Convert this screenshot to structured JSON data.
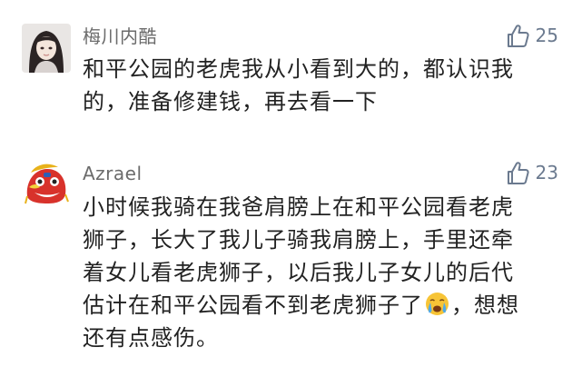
{
  "comments": [
    {
      "username": "梅川内酷",
      "likes": "25",
      "lines": [
        "和平公园的老虎我从小看到大的，都认识我",
        "的，准备修建钱，再去看一下"
      ]
    },
    {
      "username": "Azrael",
      "likes": "23",
      "lines": [
        "小时候我骑在我爸肩膀上在和平公园看老虎",
        "狮子，长大了我儿子骑我肩膀上，手里还牵",
        "着女儿看老虎狮子，以后我儿子女儿的后代",
        "估计在和平公园看不到老虎狮子了",
        "，想想",
        "还有点感伤。"
      ],
      "emoji": "crying-face-emoji"
    }
  ],
  "colors": {
    "like_icon": "#6b7a8f",
    "username": "#6b6b6b",
    "text": "#222222"
  }
}
